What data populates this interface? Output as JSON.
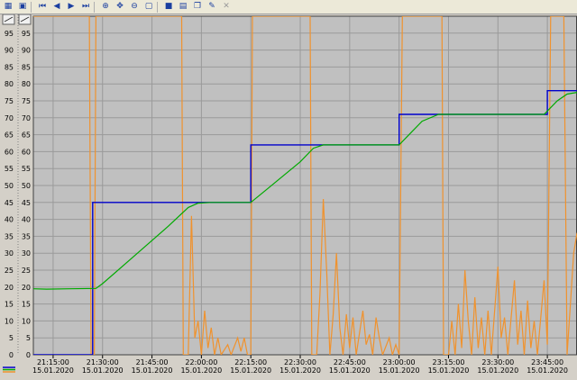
{
  "toolbar": {
    "icons": [
      "grid-icon",
      "export-icon",
      "first-icon",
      "prev-icon",
      "next-icon",
      "last-icon",
      "zoom-in-icon",
      "pan-icon",
      "zoom-out-icon",
      "rect-zoom-icon",
      "stop-icon",
      "print-icon",
      "copy-icon",
      "settings-icon",
      "exit-icon"
    ]
  },
  "chart_data": {
    "type": "line",
    "title": "",
    "xlabel": "",
    "ylabel": "",
    "ylim": [
      0,
      100
    ],
    "y_ticks": [
      0,
      5,
      10,
      15,
      20,
      25,
      30,
      35,
      40,
      45,
      50,
      55,
      60,
      65,
      70,
      75,
      80,
      85,
      90,
      95
    ],
    "x_range": [
      "2020-01-15 21:09",
      "2020-01-15 23:54"
    ],
    "x_ticks": [
      {
        "time": "21:15:00",
        "date": "15.01.2020"
      },
      {
        "time": "21:30:00",
        "date": "15.01.2020"
      },
      {
        "time": "21:45:00",
        "date": "15.01.2020"
      },
      {
        "time": "22:00:00",
        "date": "15.01.2020"
      },
      {
        "time": "22:15:00",
        "date": "15.01.2020"
      },
      {
        "time": "22:30:00",
        "date": "15.01.2020"
      },
      {
        "time": "22:45:00",
        "date": "15.01.2020"
      },
      {
        "time": "23:00:00",
        "date": "15.01.2020"
      },
      {
        "time": "23:15:00",
        "date": "15.01.2020"
      },
      {
        "time": "23:30:00",
        "date": "15.01.2020"
      },
      {
        "time": "23:45:00",
        "date": "15.01.2020"
      }
    ],
    "grid": true,
    "background": "#c0c0c0",
    "grid_color": "#9a9a9a",
    "series": [
      {
        "color": "#0000cc",
        "points": [
          [
            "21:09",
            0
          ],
          [
            "21:27",
            0
          ],
          [
            "21:27",
            45
          ],
          [
            "22:15",
            45
          ],
          [
            "22:15",
            62
          ],
          [
            "23:00",
            62
          ],
          [
            "23:00",
            71
          ],
          [
            "23:45",
            71
          ],
          [
            "23:45",
            78
          ],
          [
            "23:54",
            78
          ]
        ]
      },
      {
        "color": "#00aa00",
        "points": [
          [
            "21:09",
            19.5
          ],
          [
            "21:13",
            19.4
          ],
          [
            "21:20",
            19.5
          ],
          [
            "21:28",
            19.6
          ],
          [
            "21:30",
            21
          ],
          [
            "21:40",
            29.5
          ],
          [
            "21:50",
            38
          ],
          [
            "21:56",
            43.5
          ],
          [
            "21:59",
            44.8
          ],
          [
            "22:03",
            45
          ],
          [
            "22:15",
            45
          ],
          [
            "22:20",
            49
          ],
          [
            "22:30",
            57
          ],
          [
            "22:34",
            61
          ],
          [
            "22:37",
            62
          ],
          [
            "23:00",
            62
          ],
          [
            "23:04",
            66
          ],
          [
            "23:07",
            69
          ],
          [
            "23:12",
            71
          ],
          [
            "23:44",
            71
          ],
          [
            "23:48",
            75
          ],
          [
            "23:51",
            77
          ],
          [
            "23:54",
            77.5
          ]
        ]
      },
      {
        "color": "#f0922d",
        "points": [
          [
            "21:09",
            100
          ],
          [
            "21:12",
            100
          ],
          [
            "21:26",
            100
          ],
          [
            "21:26.5",
            0
          ],
          [
            "21:27.5",
            0
          ],
          [
            "21:28",
            100
          ],
          [
            "21:54",
            100
          ],
          [
            "21:54.5",
            0
          ],
          [
            "21:56",
            0
          ],
          [
            "21:57",
            41
          ],
          [
            "21:58",
            5
          ],
          [
            "21:59",
            10
          ],
          [
            "22:00",
            0
          ],
          [
            "22:01",
            13
          ],
          [
            "22:02",
            2
          ],
          [
            "22:03",
            8
          ],
          [
            "22:04",
            0
          ],
          [
            "22:05",
            5
          ],
          [
            "22:06",
            0
          ],
          [
            "22:08",
            3
          ],
          [
            "22:09",
            0
          ],
          [
            "22:11",
            5
          ],
          [
            "22:12",
            1
          ],
          [
            "22:13",
            5
          ],
          [
            "22:14",
            0
          ],
          [
            "22:15",
            0
          ],
          [
            "22:15.5",
            100
          ],
          [
            "22:33",
            100
          ],
          [
            "22:33.5",
            0
          ],
          [
            "22:35",
            0
          ],
          [
            "22:36",
            18
          ],
          [
            "22:37",
            46
          ],
          [
            "22:38",
            25
          ],
          [
            "22:39",
            0
          ],
          [
            "22:40",
            12
          ],
          [
            "22:41",
            30
          ],
          [
            "22:42",
            8
          ],
          [
            "22:43",
            0
          ],
          [
            "22:44",
            12
          ],
          [
            "22:45",
            2
          ],
          [
            "22:46",
            11
          ],
          [
            "22:47",
            0
          ],
          [
            "22:49",
            13
          ],
          [
            "22:50",
            3
          ],
          [
            "22:51",
            6
          ],
          [
            "22:52",
            0
          ],
          [
            "22:53",
            11
          ],
          [
            "22:54",
            5
          ],
          [
            "22:55",
            0
          ],
          [
            "22:57",
            5
          ],
          [
            "22:58",
            0
          ],
          [
            "22:59",
            3
          ],
          [
            "23:00",
            0
          ],
          [
            "23:01",
            100
          ],
          [
            "23:13",
            100
          ],
          [
            "23:13.5",
            0
          ],
          [
            "23:15",
            0
          ],
          [
            "23:16",
            10
          ],
          [
            "23:17",
            0
          ],
          [
            "23:18",
            15
          ],
          [
            "23:19",
            2
          ],
          [
            "23:20",
            25
          ],
          [
            "23:21",
            10
          ],
          [
            "23:22",
            0
          ],
          [
            "23:23",
            17
          ],
          [
            "23:24",
            2
          ],
          [
            "23:25",
            11
          ],
          [
            "23:26",
            0
          ],
          [
            "23:27",
            13
          ],
          [
            "23:28",
            0
          ],
          [
            "23:30",
            26
          ],
          [
            "23:31",
            5
          ],
          [
            "23:32",
            11
          ],
          [
            "23:33",
            0
          ],
          [
            "23:35",
            22
          ],
          [
            "23:36",
            3
          ],
          [
            "23:37",
            13
          ],
          [
            "23:38",
            0
          ],
          [
            "23:39",
            16
          ],
          [
            "23:40",
            2
          ],
          [
            "23:41",
            10
          ],
          [
            "23:42",
            0
          ],
          [
            "23:44",
            22
          ],
          [
            "23:45",
            3
          ],
          [
            "23:46",
            100
          ],
          [
            "23:50",
            100
          ],
          [
            "23:51",
            0
          ],
          [
            "23:52",
            15
          ],
          [
            "23:53",
            30
          ],
          [
            "23:54",
            36
          ]
        ]
      }
    ],
    "legend_swatches": [
      "#0000cc",
      "#00aa00",
      "#f0922d"
    ]
  }
}
